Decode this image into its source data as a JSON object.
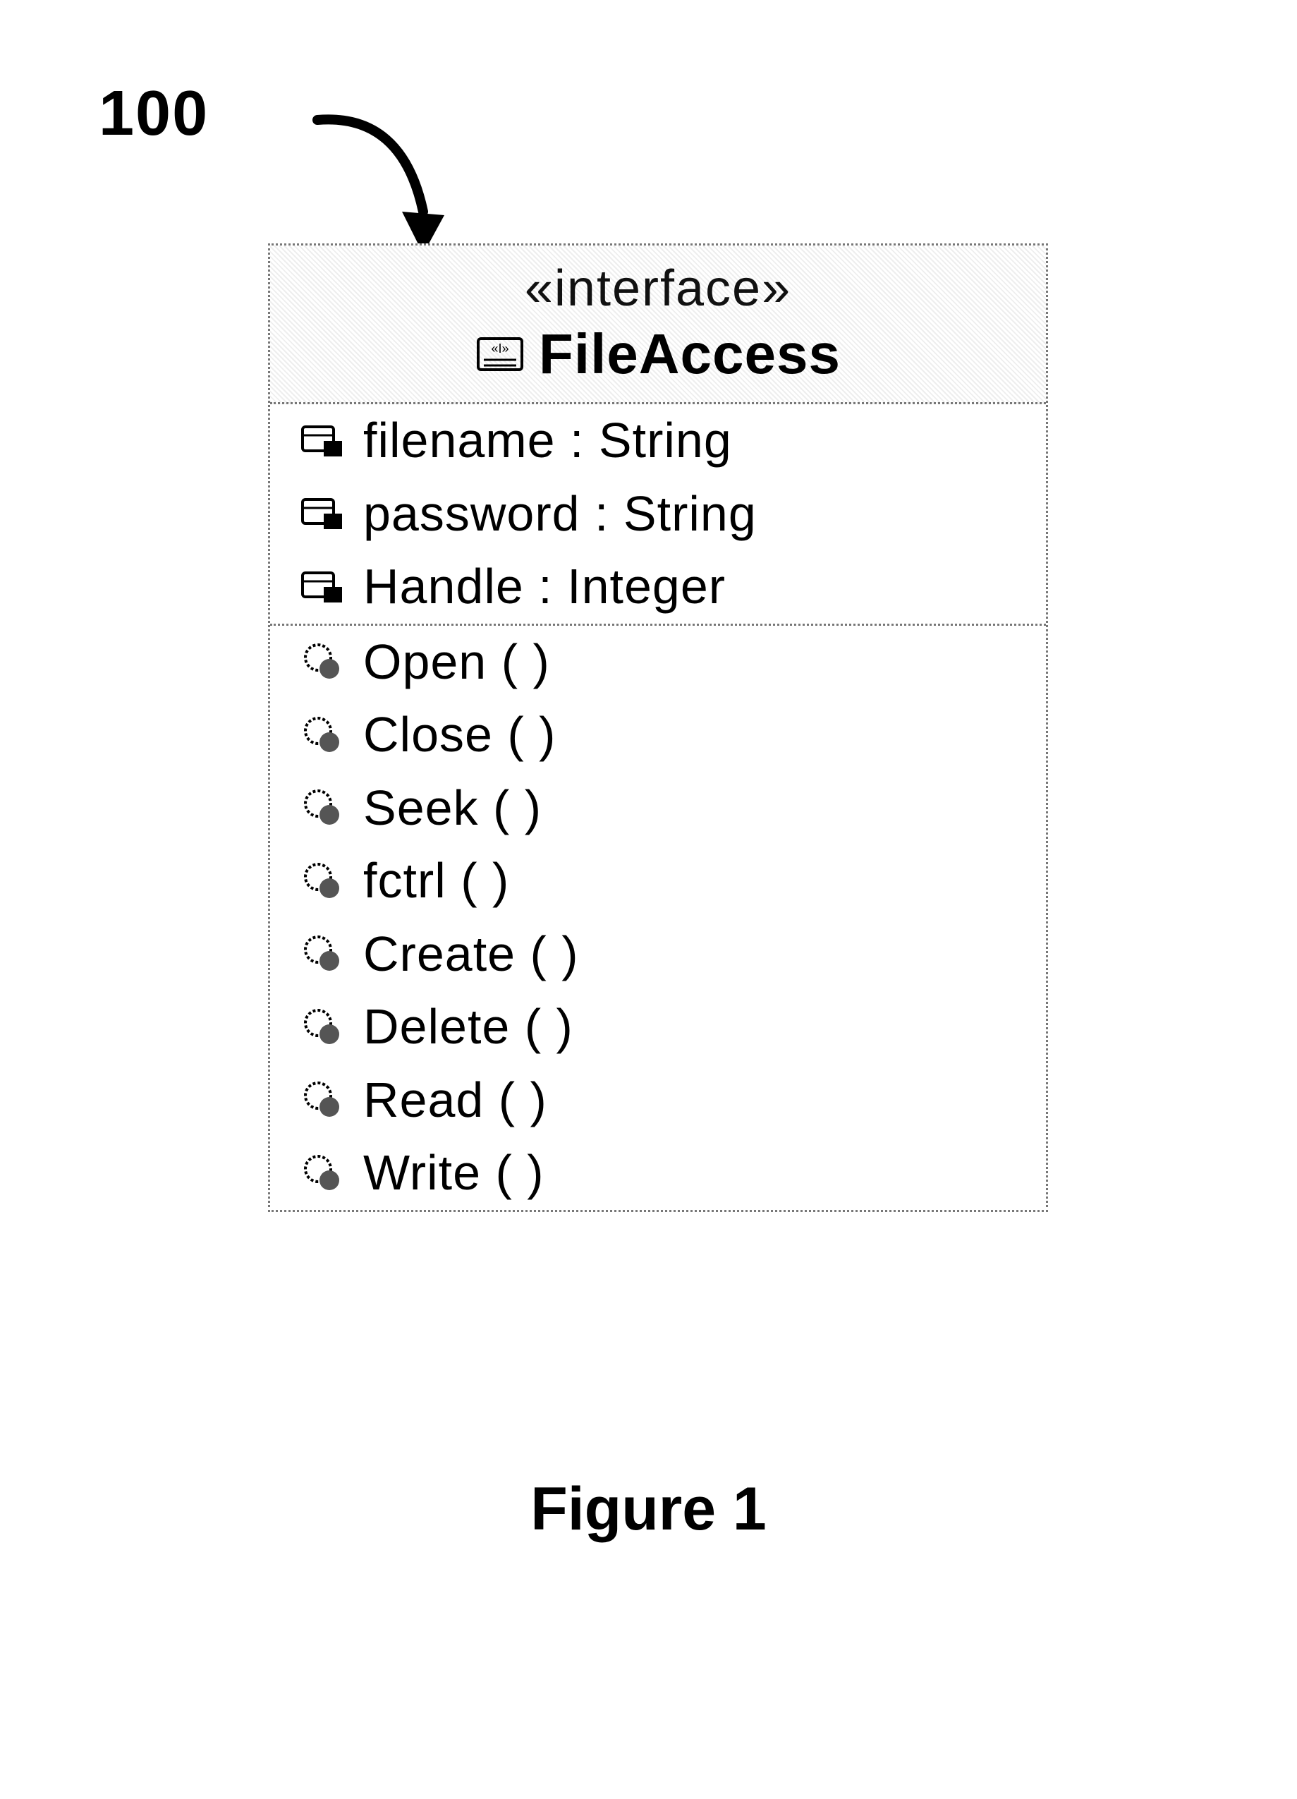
{
  "reference": {
    "number": "100"
  },
  "uml": {
    "stereotype": "«interface»",
    "name": "FileAccess",
    "attributes": [
      {
        "text": "filename : String"
      },
      {
        "text": "password : String"
      },
      {
        "text": "Handle : Integer"
      }
    ],
    "operations": [
      {
        "text": "Open ( )"
      },
      {
        "text": "Close ( )"
      },
      {
        "text": "Seek ( )"
      },
      {
        "text": "fctrl ( )"
      },
      {
        "text": "Create ( )"
      },
      {
        "text": "Delete ( )"
      },
      {
        "text": "Read ( )"
      },
      {
        "text": "Write ( )"
      }
    ]
  },
  "caption": "Figure 1"
}
